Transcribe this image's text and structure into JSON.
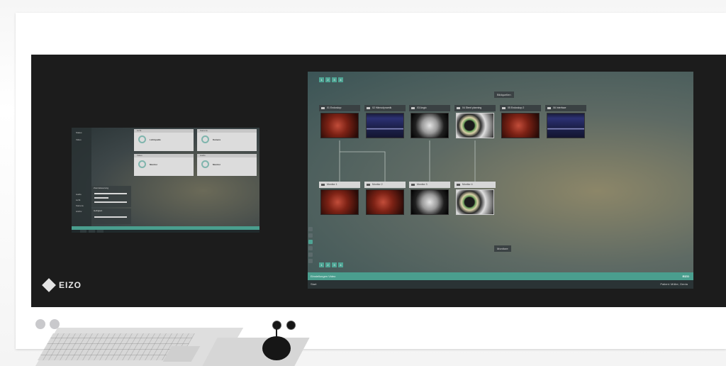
{
  "brand": {
    "logo_text": "EIZO"
  },
  "small_monitor": {
    "left_labels": [
      "Status",
      "Video",
      "Audio",
      "Licht",
      "Kamera",
      "Archiv"
    ],
    "cards": [
      {
        "title": "Licht",
        "value": "Lichtquelle"
      },
      {
        "title": "Kamera",
        "value": "Kamera"
      },
      {
        "title": "Video",
        "value": "Monitor"
      },
      {
        "title": "Audio",
        "value": "Monitor"
      }
    ],
    "panels": [
      {
        "title": "Zoomsteuerung"
      },
      {
        "title": "Helligkeit"
      }
    ]
  },
  "large_monitor": {
    "toolbar": [
      "1",
      "2",
      "3",
      "4"
    ],
    "bottom_toolbar": [
      "1",
      "2",
      "3",
      "4"
    ],
    "sources_label": "Bildquellen",
    "monitors_label": "Monitore",
    "sources": [
      {
        "title": "01 Endoskop",
        "image": "surgery"
      },
      {
        "title": "02 Hämodynamik",
        "image": "hemo"
      },
      {
        "title": "03 Angio",
        "image": "angio"
      },
      {
        "title": "04 Stent planning",
        "image": "stent"
      },
      {
        "title": "05 Endoskop 2",
        "image": "surgery"
      },
      {
        "title": "06 Interface",
        "image": "hemo"
      }
    ],
    "monitors": [
      {
        "title": "Monitor 1",
        "image": "surgery"
      },
      {
        "title": "Monitor 2",
        "image": "surgery"
      },
      {
        "title": "Monitor 3",
        "image": "angio"
      },
      {
        "title": "Monitor 4",
        "image": "stent"
      }
    ],
    "bottom_bar_text": "Einstellungen Video",
    "brand_text": "EIZO",
    "status_left": "Start",
    "status_right": "Patient: Müller, Gerda"
  },
  "colors": {
    "accent": "#4a9e8e",
    "screen_bezel": "#1c1c1c"
  }
}
